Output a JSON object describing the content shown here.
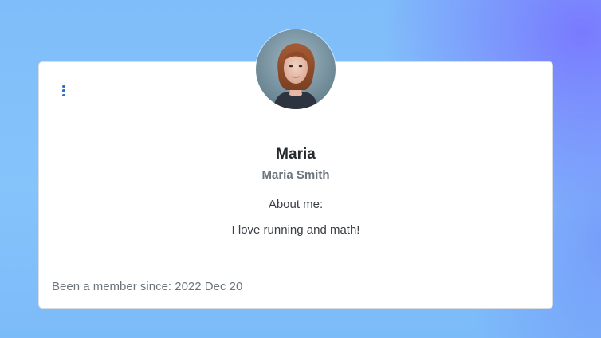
{
  "profile": {
    "display_name": "Maria",
    "full_name": "Maria Smith",
    "about_label": "About me:",
    "about_text": "I love running and math!",
    "member_since": "Been a member since: 2022 Dec 20"
  },
  "icons": {
    "menu": "vertical-ellipsis-icon",
    "avatar": "profile-photo"
  },
  "colors": {
    "accent": "#2f6fc8",
    "card_background": "#ffffff",
    "page_background": "#82c0fa"
  }
}
